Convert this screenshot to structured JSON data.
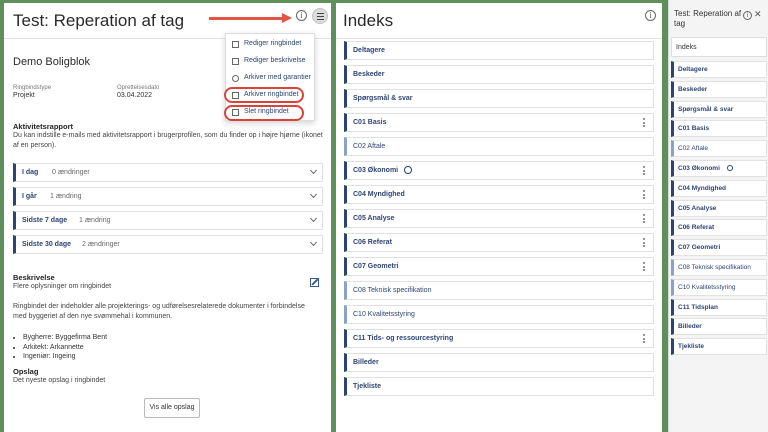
{
  "left": {
    "title": "Test: Reperation af tag",
    "subtitle": "Demo Boligblok",
    "meta": [
      {
        "label": "Ringbindstype",
        "value": "Projekt"
      },
      {
        "label": "Oprettelsesdato",
        "value": "03.04.2022"
      }
    ],
    "activity": {
      "heading": "Aktivitetsrapport",
      "text": "Du kan indstille e-mails med aktivitetsrapport i brugerprofilen, som du finder op i højre hjørne (ikonet af en person).",
      "rows": [
        {
          "label": "I dag",
          "count": "0 ændringer"
        },
        {
          "label": "I går",
          "count": "1 ændring"
        },
        {
          "label": "Sidste 7 dage",
          "count": "1 ændring"
        },
        {
          "label": "Sidste 30 dage",
          "count": "2 ændringer"
        }
      ]
    },
    "description": {
      "heading": "Beskrivelse",
      "sub": "Flere oplysninger om ringbindet",
      "text": "Ringbindet der indeholder alle projekterings- og udførelsesrelaterede dokumenter i forbindelse med byggeriet af den nye svømmehal i kommunen.",
      "bullets": [
        "Bygherre: Byggefirma Bent",
        "Arkitekt: Arkannette",
        "Ingeniør: Ingeing"
      ]
    },
    "posts": {
      "heading": "Opslag",
      "sub": "Det nyeste opslag i ringbindet",
      "button": "Vis alle opslag"
    },
    "menu": [
      "Rediger ringbindet",
      "Rediger beskrivelse",
      "Arkiver med garantier",
      "Arkiver ringbindet",
      "Slet ringbindet"
    ]
  },
  "index": {
    "title": "Indeks",
    "items": [
      {
        "label": "Deltagere",
        "bold": true
      },
      {
        "label": "Beskeder",
        "bold": true
      },
      {
        "label": "Spørgsmål & svar",
        "bold": true
      },
      {
        "label": "C01 Basis",
        "bold": true
      },
      {
        "label": "C02 Aftale",
        "bold": false
      },
      {
        "label": "C03 Økonomi",
        "bold": true
      },
      {
        "label": "C04 Myndighed",
        "bold": true
      },
      {
        "label": "C05 Analyse",
        "bold": true
      },
      {
        "label": "C06 Referat",
        "bold": true
      },
      {
        "label": "C07 Geometri",
        "bold": true
      },
      {
        "label": "C08 Teknisk specifikation",
        "bold": false
      },
      {
        "label": "C10 Kvalitetsstyring",
        "bold": false
      },
      {
        "label": "C11 Tids- og ressourcestyring",
        "bold": true
      },
      {
        "label": "Billeder",
        "bold": true
      },
      {
        "label": "Tjekliste",
        "bold": true
      }
    ]
  },
  "right": {
    "title": "Test: Reperation af tag",
    "tab": "Indeks",
    "close": "✕",
    "items": [
      {
        "label": "Deltagere",
        "bold": true
      },
      {
        "label": "Beskeder",
        "bold": true
      },
      {
        "label": "Spørgsmål & svar",
        "bold": true
      },
      {
        "label": "C01 Basis",
        "bold": true
      },
      {
        "label": "C02 Aftale",
        "bold": false
      },
      {
        "label": "C03 Økonomi",
        "bold": true
      },
      {
        "label": "C04 Myndighed",
        "bold": true
      },
      {
        "label": "C05 Analyse",
        "bold": true
      },
      {
        "label": "C06 Referat",
        "bold": true
      },
      {
        "label": "C07 Geometri",
        "bold": true
      },
      {
        "label": "C08 Teknisk specifikation",
        "bold": false
      },
      {
        "label": "C10 Kvalitetsstyring",
        "bold": false
      },
      {
        "label": "C11 Tidsplan",
        "bold": true
      },
      {
        "label": "Billeder",
        "bold": true
      },
      {
        "label": "Tjekliste",
        "bold": true
      }
    ]
  },
  "colors": {
    "frame": "#5f8f5a",
    "accent": "#2d4473",
    "annotation": "#e25545"
  }
}
